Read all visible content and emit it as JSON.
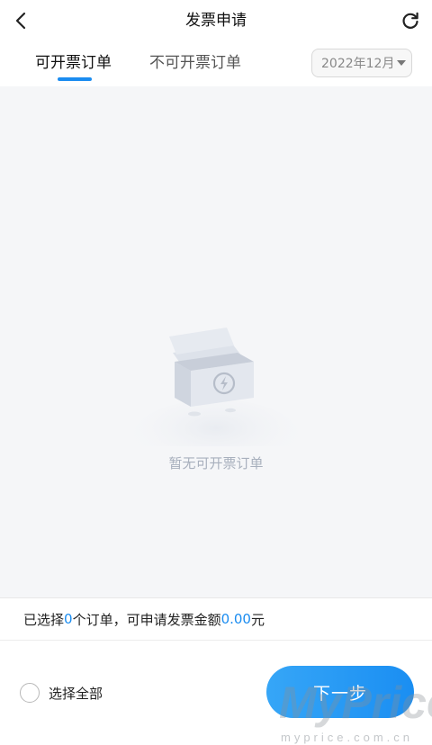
{
  "header": {
    "title": "发票申请",
    "back_icon": "chevron-left-icon",
    "refresh_icon": "refresh-icon"
  },
  "tabs": [
    {
      "label": "可开票订单",
      "active": true
    },
    {
      "label": "不可开票订单",
      "active": false
    }
  ],
  "month_filter": {
    "value": "2022年12月"
  },
  "empty_state": {
    "text": "暂无可开票订单"
  },
  "summary": {
    "prefix": "已选择",
    "count": "0",
    "middle": "个订单，可申请发票金额",
    "amount": "0.00",
    "suffix": "元"
  },
  "footer": {
    "select_all_label": "选择全部",
    "next_label": "下一步"
  },
  "watermark": {
    "brand": "MyPrice",
    "url": "myprice.com.cn"
  },
  "colors": {
    "accent": "#1a8cf0",
    "background": "#f5f6f8",
    "empty_text": "#a8b0bd"
  }
}
